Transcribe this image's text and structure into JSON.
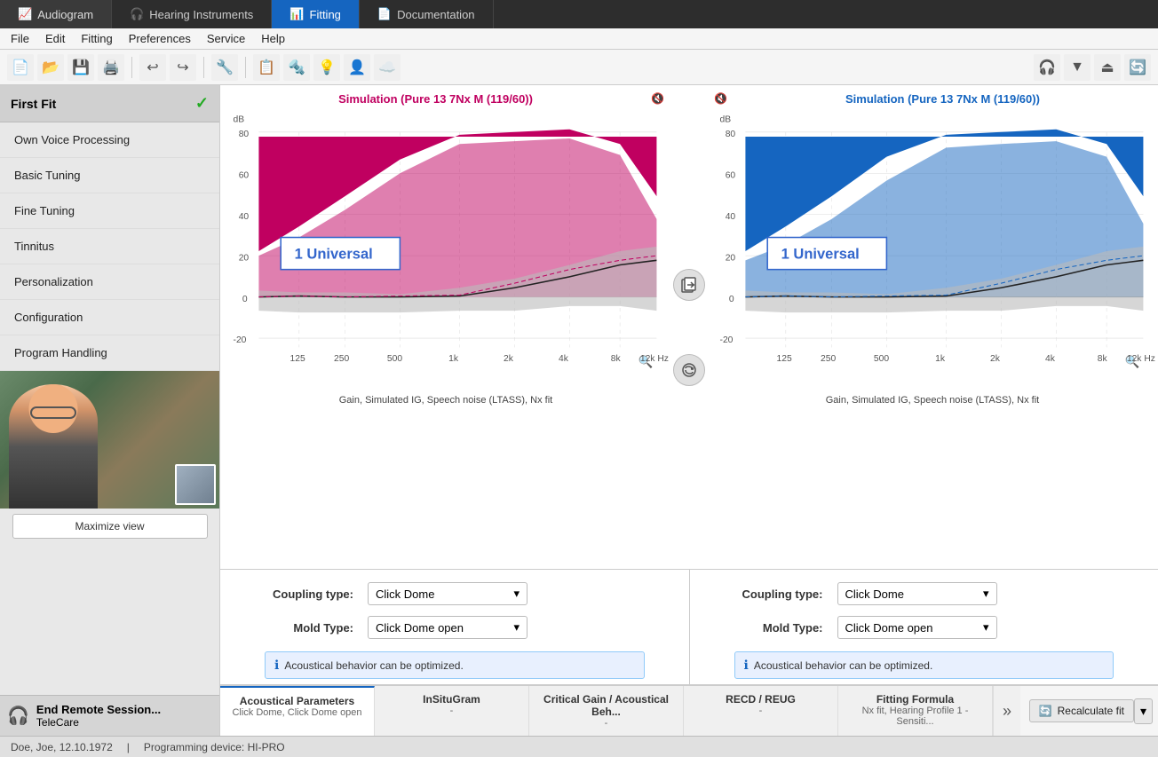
{
  "titleBar": {
    "tabs": [
      {
        "id": "audiogram",
        "label": "Audiogram",
        "icon": "📈",
        "active": false
      },
      {
        "id": "hearing",
        "label": "Hearing Instruments",
        "icon": "🎧",
        "active": false
      },
      {
        "id": "fitting",
        "label": "Fitting",
        "icon": "📊",
        "active": true
      },
      {
        "id": "documentation",
        "label": "Documentation",
        "icon": "📄",
        "active": false
      }
    ]
  },
  "menuBar": {
    "items": [
      "File",
      "Edit",
      "Fitting",
      "Preferences",
      "Service",
      "Help"
    ]
  },
  "sidebar": {
    "firstFit": "First Fit",
    "checkMark": "✓",
    "items": [
      {
        "id": "own-voice",
        "label": "Own Voice Processing"
      },
      {
        "id": "basic-tuning",
        "label": "Basic Tuning"
      },
      {
        "id": "fine-tuning",
        "label": "Fine Tuning"
      },
      {
        "id": "tinnitus",
        "label": "Tinnitus"
      },
      {
        "id": "personalization",
        "label": "Personalization"
      },
      {
        "id": "configuration",
        "label": "Configuration"
      },
      {
        "id": "program-handling",
        "label": "Program Handling"
      }
    ],
    "maximizeBtn": "Maximize view",
    "remoteSession": {
      "title": "End Remote Session...",
      "subtitle": "TeleCare"
    }
  },
  "charts": {
    "left": {
      "title": "Simulation (Pure 13 7Nx M (119/60))",
      "program": "1 Universal",
      "xLabels": [
        "125",
        "250",
        "500",
        "1k",
        "2k",
        "4k",
        "8k",
        "12k Hz"
      ],
      "yLabels": [
        "80",
        "60",
        "40",
        "20",
        "0",
        "-20"
      ],
      "dBLabel": "dB",
      "chartLabel": "Gain, Simulated IG, Speech noise (LTASS), Nx fit"
    },
    "right": {
      "title": "Simulation (Pure 13 7Nx M (119/60))",
      "program": "1 Universal",
      "xLabels": [
        "125",
        "250",
        "500",
        "1k",
        "2k",
        "4k",
        "8k",
        "12k Hz"
      ],
      "yLabels": [
        "80",
        "60",
        "40",
        "20",
        "0",
        "-20"
      ],
      "dBLabel": "dB",
      "chartLabel": "Gain, Simulated IG, Speech noise (LTASS), Nx fit"
    }
  },
  "coupling": {
    "left": {
      "couplingLabel": "Coupling type:",
      "couplingValue": "Click Dome",
      "moldLabel": "Mold Type:",
      "moldValue": "Click Dome open",
      "infoText": "Acoustical behavior can be optimized."
    },
    "right": {
      "couplingLabel": "Coupling type:",
      "couplingValue": "Click Dome",
      "moldLabel": "Mold Type:",
      "moldValue": "Click Dome open",
      "infoText": "Acoustical behavior can be optimized."
    }
  },
  "bottomTabs": [
    {
      "id": "acoustical",
      "label": "Acoustical Parameters",
      "sub": "Click Dome, Click Dome open",
      "active": true
    },
    {
      "id": "insitugram",
      "label": "InSituGram",
      "sub": "-",
      "active": false
    },
    {
      "id": "critical",
      "label": "Critical Gain / Acoustical Beh...",
      "sub": "-",
      "active": false
    },
    {
      "id": "recd",
      "label": "RECD / REUG",
      "sub": "-",
      "active": false
    },
    {
      "id": "fitting-formula",
      "label": "Fitting Formula",
      "sub": "Nx fit, Hearing Profile 1 - Sensiti...",
      "active": false
    }
  ],
  "recalculate": {
    "label": "Recalculate fit"
  },
  "statusBar": {
    "patient": "Doe, Joe, 12.10.1972",
    "device": "Programming device: HI-PRO"
  }
}
